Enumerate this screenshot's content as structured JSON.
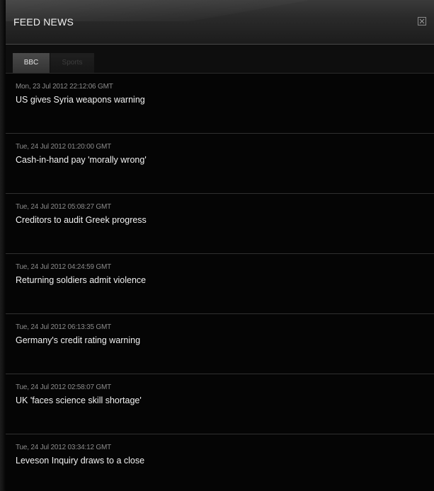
{
  "window": {
    "title": "FEED NEWS",
    "close_icon": "close-icon"
  },
  "tabs": [
    {
      "label": "BBC",
      "active": true
    },
    {
      "label": "Sports",
      "active": false
    }
  ],
  "feed": {
    "items": [
      {
        "date": "Mon, 23 Jul 2012 22:12:06 GMT",
        "headline": "US gives Syria weapons warning"
      },
      {
        "date": "Tue, 24 Jul 2012 01:20:00 GMT",
        "headline": "Cash-in-hand pay 'morally wrong'"
      },
      {
        "date": "Tue, 24 Jul 2012 05:08:27 GMT",
        "headline": "Creditors to audit Greek progress"
      },
      {
        "date": "Tue, 24 Jul 2012 04:24:59 GMT",
        "headline": "Returning soldiers admit violence"
      },
      {
        "date": "Tue, 24 Jul 2012 06:13:35 GMT",
        "headline": "Germany's credit rating warning"
      },
      {
        "date": "Tue, 24 Jul 2012 02:58:07 GMT",
        "headline": "UK 'faces science skill shortage'"
      },
      {
        "date": "Tue, 24 Jul 2012 03:34:12 GMT",
        "headline": "Leveson Inquiry draws to a close"
      }
    ]
  },
  "colors": {
    "background": "#050505",
    "title_text": "#f0f0f0",
    "date_text": "#8c8c8c",
    "headline_text": "#f2f2f2",
    "active_tab": "#444444",
    "inactive_tab_text": "#3e3e3e"
  }
}
